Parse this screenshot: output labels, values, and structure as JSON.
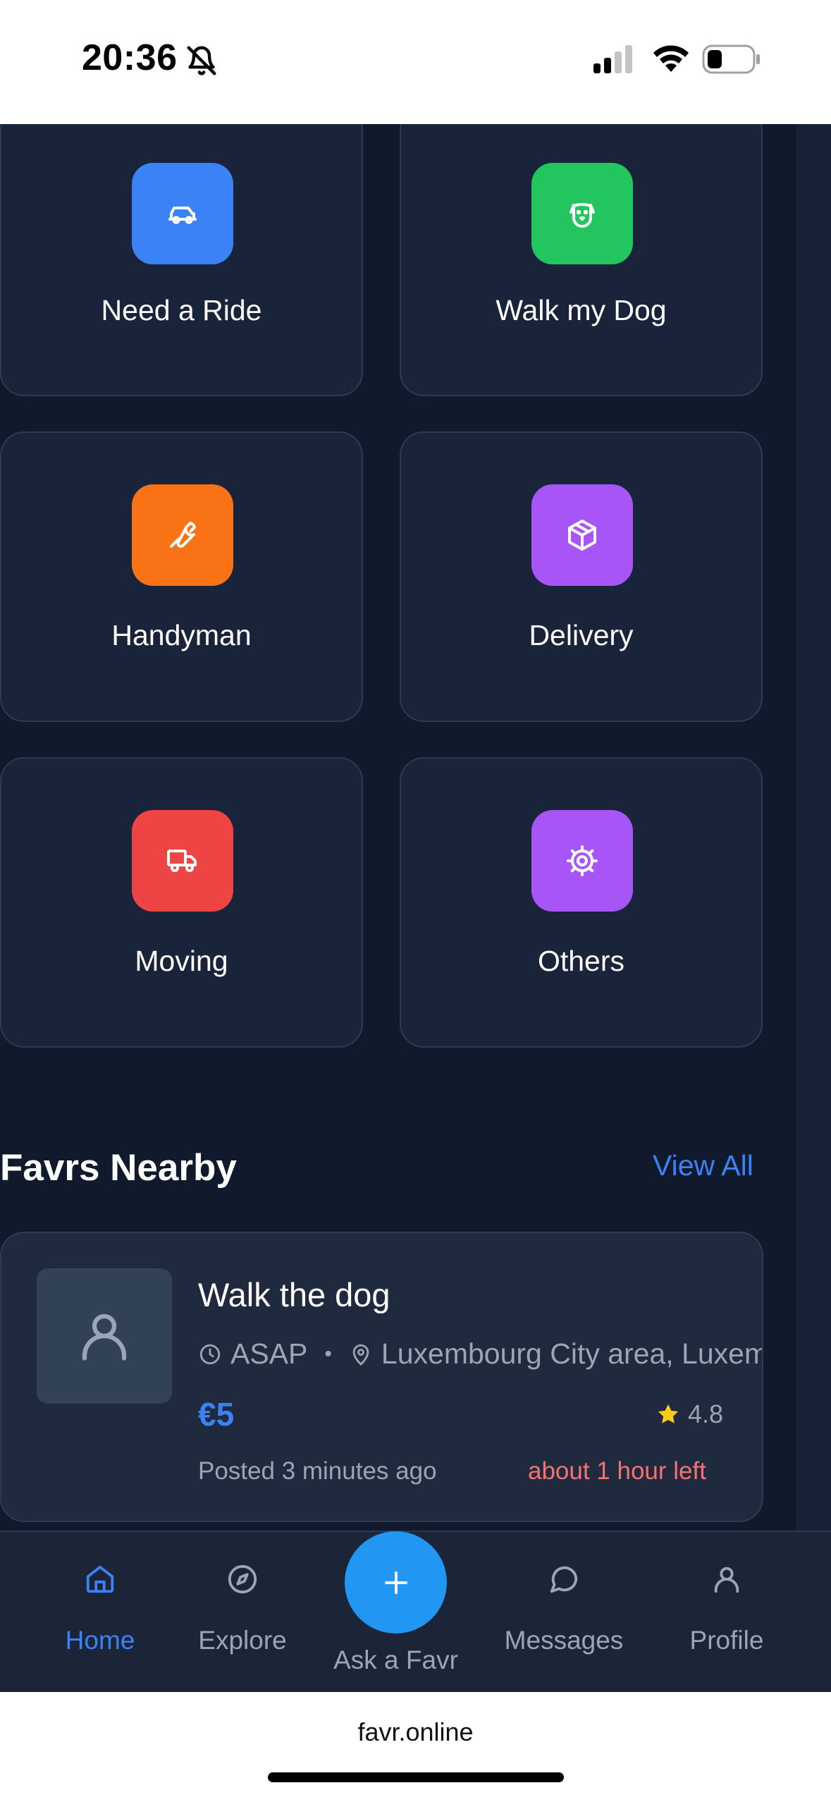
{
  "status_bar": {
    "time": "20:36"
  },
  "categories": [
    {
      "label": "Need a Ride",
      "icon": "car-icon",
      "color": "#3b82f6"
    },
    {
      "label": "Walk my Dog",
      "icon": "dog-icon",
      "color": "#22c55e"
    },
    {
      "label": "Handyman",
      "icon": "wrench-icon",
      "color": "#f97316"
    },
    {
      "label": "Delivery",
      "icon": "package-icon",
      "color": "#a855f7"
    },
    {
      "label": "Moving",
      "icon": "truck-icon",
      "color": "#ef4444"
    },
    {
      "label": "Others",
      "icon": "gear-icon",
      "color": "#a855f7"
    }
  ],
  "nearby": {
    "title": "Favrs Nearby",
    "view_all": "View All",
    "items": [
      {
        "title": "Walk the dog",
        "when": "ASAP",
        "separator": "•",
        "location": "Luxembourg City area, Luxembo",
        "price": "€5",
        "rating": "4.8",
        "posted": "Posted 3 minutes ago",
        "time_left": "about 1 hour left"
      }
    ]
  },
  "nav": {
    "home": "Home",
    "explore": "Explore",
    "ask": "Ask a Favr",
    "messages": "Messages",
    "profile": "Profile"
  },
  "browser": {
    "url": "favr.online"
  },
  "colors": {
    "accent": "#3b82f6",
    "background": "#111a2c",
    "card": "#19233a",
    "urgent": "#f87171",
    "fab": "#2196f3"
  }
}
